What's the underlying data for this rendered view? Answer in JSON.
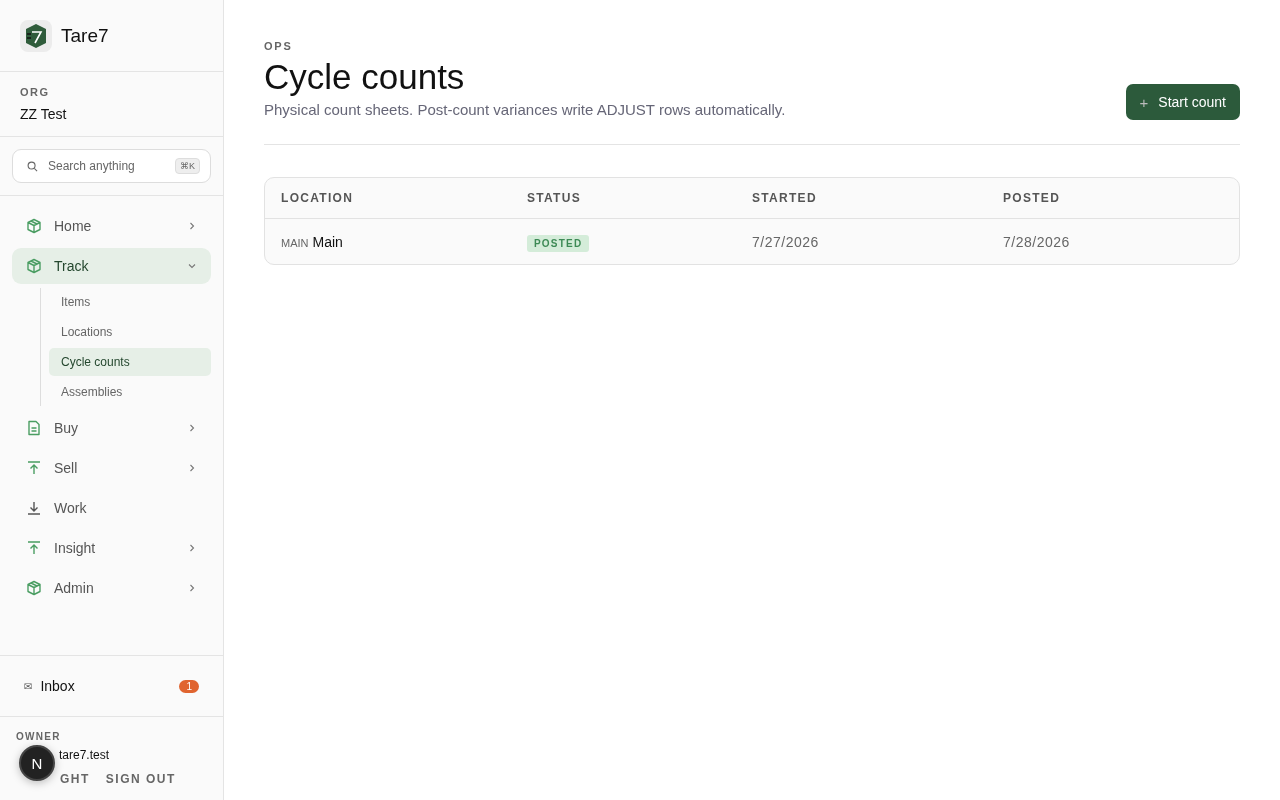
{
  "brand": {
    "name": "Tare7"
  },
  "org": {
    "label": "ORG",
    "name": "ZZ Test"
  },
  "search": {
    "placeholder": "Search anything",
    "shortcut": "⌘K"
  },
  "nav": [
    {
      "label": "Home",
      "kind": "box",
      "selected": false,
      "expanded": false
    },
    {
      "label": "Track",
      "kind": "box",
      "selected": true,
      "expanded": true,
      "children": [
        {
          "label": "Items",
          "selected": false
        },
        {
          "label": "Locations",
          "selected": false
        },
        {
          "label": "Cycle counts",
          "selected": true
        },
        {
          "label": "Assemblies",
          "selected": false
        }
      ]
    },
    {
      "label": "Buy",
      "kind": "doc",
      "selected": false,
      "expanded": false
    },
    {
      "label": "Sell",
      "kind": "up",
      "selected": false,
      "expanded": false
    },
    {
      "label": "Work",
      "kind": "down",
      "selected": false
    },
    {
      "label": "Insight",
      "kind": "up",
      "selected": false,
      "expanded": false
    },
    {
      "label": "Admin",
      "kind": "box",
      "selected": false,
      "expanded": false
    }
  ],
  "inbox": {
    "label": "Inbox",
    "icon": "✉",
    "count": "1"
  },
  "user": {
    "role": "OWNER",
    "email": "tare7.test",
    "theme": "GHT",
    "sign_out": "SIGN OUT"
  },
  "dev_badge": {
    "letter": "N"
  },
  "page": {
    "eyebrow": "OPS",
    "title": "Cycle counts",
    "subtitle": "Physical count sheets. Post-count variances write ADJUST rows automatically.",
    "action": {
      "icon": "+",
      "label": "Start count"
    }
  },
  "table": {
    "columns": [
      "LOCATION",
      "STATUS",
      "STARTED",
      "POSTED"
    ],
    "rows": [
      {
        "location_code": "MAIN",
        "location": "Main",
        "status": "POSTED",
        "started": "7/27/2026",
        "posted": "7/28/2026"
      }
    ]
  }
}
